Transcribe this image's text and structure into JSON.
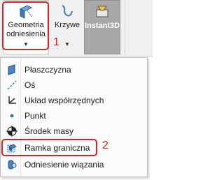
{
  "ribbon": {
    "buttons": [
      {
        "label_line1": "Geometria",
        "label_line2": "odniesienia",
        "icon": "reference-geometry-icon",
        "has_dropdown": true
      },
      {
        "label": "Krzywe",
        "icon": "curves-icon",
        "has_dropdown": true
      },
      {
        "label": "Instant3D",
        "icon": "instant3d-icon",
        "active": true
      }
    ]
  },
  "menu": {
    "items": [
      {
        "label": "Płaszczyzna",
        "icon": "plane-icon"
      },
      {
        "label": "Oś",
        "icon": "axis-icon"
      },
      {
        "label": "Układ współrzędnych",
        "icon": "coordinate-system-icon"
      },
      {
        "label": "Punkt",
        "icon": "point-icon"
      },
      {
        "label": "Środek masy",
        "icon": "center-of-mass-icon"
      },
      {
        "label": "Ramka graniczna",
        "icon": "bounding-box-icon",
        "highlighted": true
      },
      {
        "label": "Odniesienie wiązania",
        "icon": "mate-reference-icon"
      }
    ]
  },
  "callouts": {
    "first": "1",
    "second": "2"
  },
  "colors": {
    "callout_red": "#e02020",
    "ribbon_bg": "#f0f0f0",
    "active_button_bg": "#a8a8a8"
  }
}
